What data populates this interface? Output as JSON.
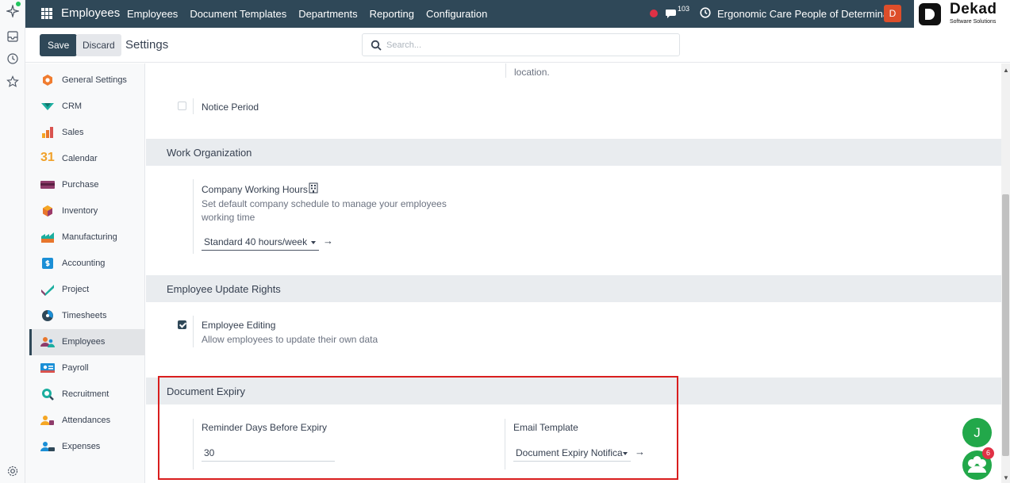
{
  "navbar": {
    "app_name": "Employees",
    "menu": [
      "Employees",
      "Document Templates",
      "Departments",
      "Reporting",
      "Configuration"
    ],
    "chat_count": "103",
    "company": "Ergonomic Care People of Determina...",
    "avatar_letter": "D",
    "accent": "#2f4858"
  },
  "brand": {
    "name": "Dekad",
    "tagline": "Software Solutions"
  },
  "control_panel": {
    "save_label": "Save",
    "discard_label": "Discard",
    "title": "Settings",
    "search_placeholder": "Search..."
  },
  "sidebar": {
    "items": [
      {
        "label": "General Settings",
        "icon": "general-settings-icon"
      },
      {
        "label": "CRM",
        "icon": "crm-icon"
      },
      {
        "label": "Sales",
        "icon": "sales-icon"
      },
      {
        "label": "Calendar",
        "icon": "calendar-icon"
      },
      {
        "label": "Purchase",
        "icon": "purchase-icon"
      },
      {
        "label": "Inventory",
        "icon": "inventory-icon"
      },
      {
        "label": "Manufacturing",
        "icon": "manufacturing-icon"
      },
      {
        "label": "Accounting",
        "icon": "accounting-icon"
      },
      {
        "label": "Project",
        "icon": "project-icon"
      },
      {
        "label": "Timesheets",
        "icon": "timesheets-icon"
      },
      {
        "label": "Employees",
        "icon": "employees-icon",
        "active": true
      },
      {
        "label": "Payroll",
        "icon": "payroll-icon"
      },
      {
        "label": "Recruitment",
        "icon": "recruitment-icon"
      },
      {
        "label": "Attendances",
        "icon": "attendances-icon"
      },
      {
        "label": "Expenses",
        "icon": "expenses-icon"
      }
    ],
    "calendar_number": "31"
  },
  "main": {
    "partial_text": "location.",
    "notice_period_label": "Notice Period",
    "work_org": {
      "heading": "Work Organization",
      "label": "Company Working Hours",
      "help": "Set default company schedule to manage your employees working time",
      "value": "Standard 40 hours/week"
    },
    "update_rights": {
      "heading": "Employee Update Rights",
      "label": "Employee Editing",
      "help": "Allow employees to update their own data",
      "checked": true
    },
    "document_expiry": {
      "heading": "Document Expiry",
      "reminder_label": "Reminder Days Before Expiry",
      "reminder_value": "30",
      "email_label": "Email Template",
      "email_value": "Document Expiry Notifica"
    }
  },
  "floating": {
    "avatar_letter": "J",
    "bot_badge": "6"
  },
  "highlight_color": "#d91e1e"
}
